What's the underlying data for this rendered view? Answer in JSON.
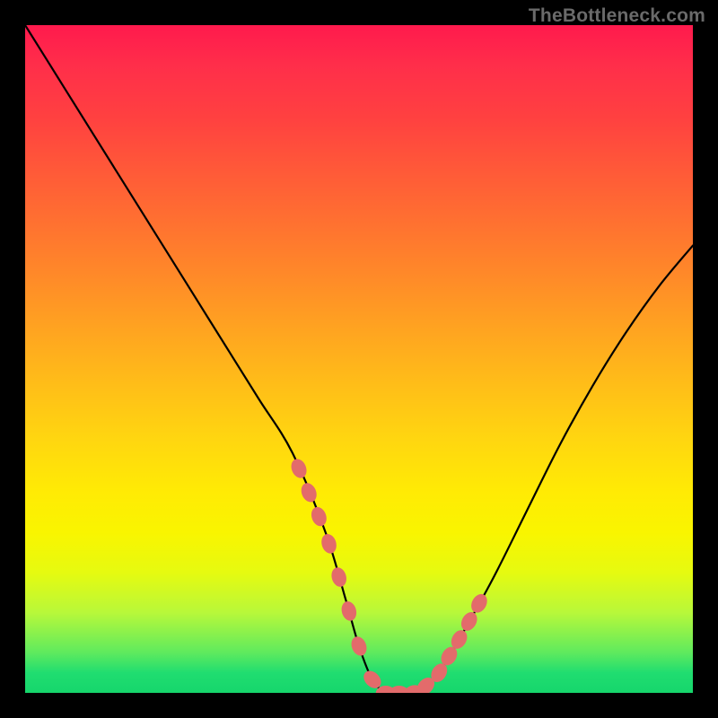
{
  "watermark": "TheBottleneck.com",
  "chart_data": {
    "type": "line",
    "title": "",
    "xlabel": "",
    "ylabel": "",
    "xlim": [
      0,
      100
    ],
    "ylim": [
      0,
      100
    ],
    "grid": false,
    "legend": false,
    "series": [
      {
        "name": "bottleneck-curve",
        "x": [
          0,
          5,
          10,
          15,
          20,
          25,
          30,
          35,
          40,
          45,
          48,
          50,
          52,
          54,
          56,
          58,
          60,
          62,
          65,
          70,
          75,
          80,
          85,
          90,
          95,
          100
        ],
        "y": [
          100,
          92,
          84,
          76,
          68,
          60,
          52,
          44,
          36,
          24,
          14,
          7,
          2,
          0,
          0,
          0,
          1,
          3,
          8,
          17,
          27,
          37,
          46,
          54,
          61,
          67
        ]
      }
    ],
    "markers": {
      "name": "highlighted-points",
      "color": "#e36b6b",
      "approx_curve_x": [
        41,
        42.5,
        44,
        45.5,
        47,
        48.5,
        50,
        52,
        54,
        56,
        58,
        60,
        62,
        63.5,
        65,
        66.5,
        68
      ]
    },
    "background_gradient": {
      "top": "#ff1a4d",
      "upper_mid": "#ffa520",
      "lower_mid": "#ffeb04",
      "bottom": "#16d66c"
    }
  }
}
